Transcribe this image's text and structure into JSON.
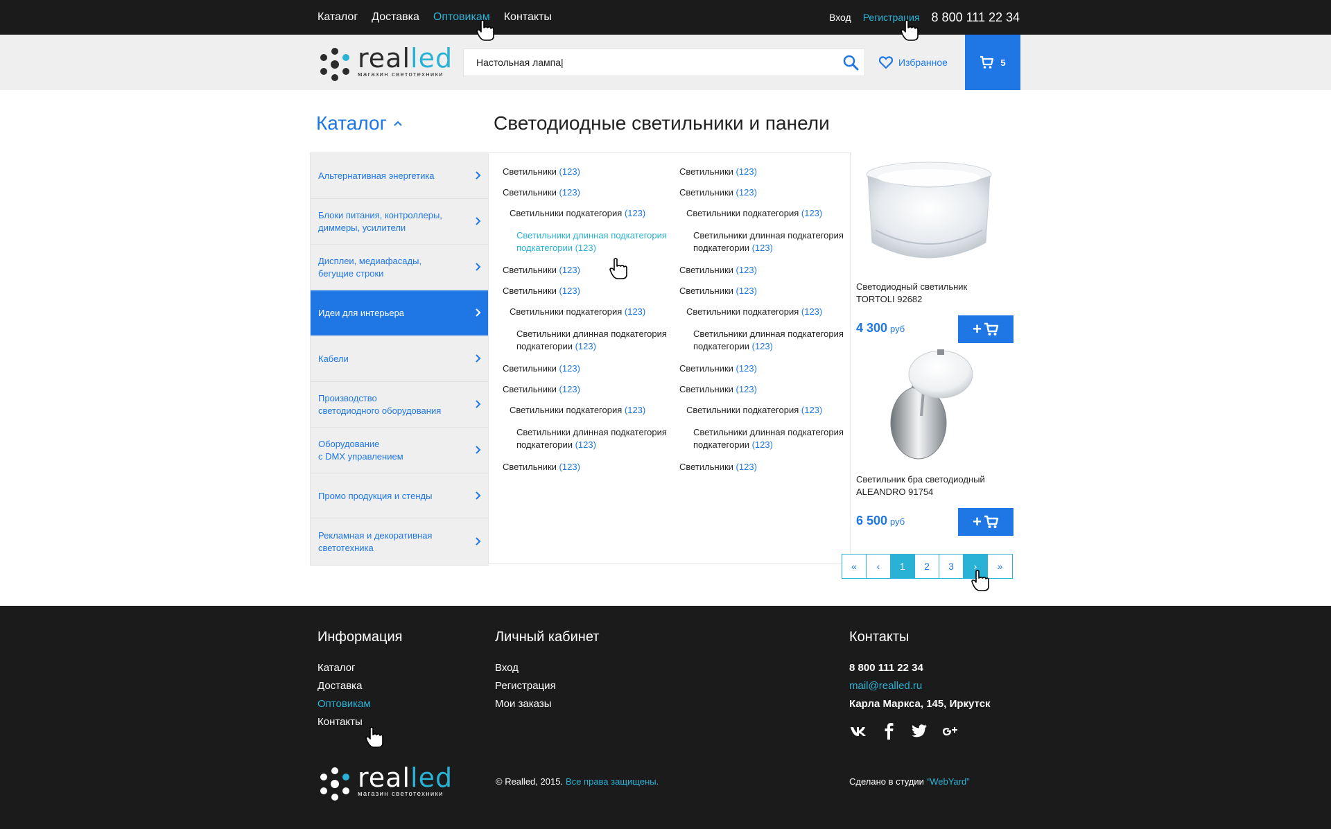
{
  "top_nav": {
    "items": [
      {
        "label": "Каталог"
      },
      {
        "label": "Доставка"
      },
      {
        "label": "Оптовикам"
      },
      {
        "label": "Контакты"
      }
    ],
    "login": "Вход",
    "register": "Регистрация",
    "phone": "8 800 111 22 34"
  },
  "logo": {
    "word_a": "real",
    "word_b": "led",
    "subtitle": "магазин светотехники"
  },
  "search": {
    "value": "Настольная лампа|",
    "icon": "search-icon"
  },
  "favorites": {
    "label": "Избранное",
    "icon": "heart-icon"
  },
  "cart": {
    "count": "5",
    "icon": "cart-icon"
  },
  "catalog_title": "Каталог",
  "page_title": "Светодиодные светильники и панели",
  "sidebar": {
    "items": [
      {
        "label": "Альтернативная энергетика",
        "active": false
      },
      {
        "label": "Блоки питания, контроллеры,\nдиммеры, усилители",
        "active": false
      },
      {
        "label": "Дисплеи, медиафасады,\nбегущие строки",
        "active": false
      },
      {
        "label": "Идеи для интерьера",
        "active": true
      },
      {
        "label": "Кабели",
        "active": false
      },
      {
        "label": "Производство\nсветодиодного оборудования",
        "active": false
      },
      {
        "label": "Оборудование\nс DMX управлением",
        "active": false
      },
      {
        "label": "Промо продукция и стенды",
        "active": false
      },
      {
        "label": "Рекламная и декоративная\nсветотехника",
        "active": false
      }
    ]
  },
  "subcats": {
    "col1": [
      {
        "text": "Светильники",
        "count": "(123)",
        "level": 1
      },
      {
        "text": "Светильники",
        "count": "(123)",
        "level": 1
      },
      {
        "text": "Светильники подкатегория",
        "count": "(123)",
        "level": 2
      },
      {
        "text": "Светильники длинная подкатегория подкатегории",
        "count": "(123)",
        "level": 3,
        "highlight": true
      },
      {
        "text": "Светильники",
        "count": "(123)",
        "level": 1
      },
      {
        "text": "Светильники",
        "count": "(123)",
        "level": 1
      },
      {
        "text": "Светильники подкатегория",
        "count": "(123)",
        "level": 2
      },
      {
        "text": "Светильники длинная подкатегория подкатегории",
        "count": "(123)",
        "level": 3
      },
      {
        "text": "Светильники",
        "count": "(123)",
        "level": 1
      },
      {
        "text": "Светильники",
        "count": "(123)",
        "level": 1
      },
      {
        "text": "Светильники подкатегория",
        "count": "(123)",
        "level": 2
      },
      {
        "text": "Светильники длинная подкатегория подкатегории",
        "count": "(123)",
        "level": 3
      },
      {
        "text": "Светильники",
        "count": "(123)",
        "level": 1
      }
    ],
    "col2": [
      {
        "text": "Светильники",
        "count": "(123)",
        "level": 1
      },
      {
        "text": "Светильники",
        "count": "(123)",
        "level": 1
      },
      {
        "text": "Светильники подкатегория",
        "count": "(123)",
        "level": 2
      },
      {
        "text": "Светильники длинная подкатегория подкатегории",
        "count": "(123)",
        "level": 3
      },
      {
        "text": "Светильники",
        "count": "(123)",
        "level": 1
      },
      {
        "text": "Светильники",
        "count": "(123)",
        "level": 1
      },
      {
        "text": "Светильники подкатегория",
        "count": "(123)",
        "level": 2
      },
      {
        "text": "Светильники длинная подкатегория подкатегории",
        "count": "(123)",
        "level": 3
      },
      {
        "text": "Светильники",
        "count": "(123)",
        "level": 1
      },
      {
        "text": "Светильники",
        "count": "(123)",
        "level": 1
      },
      {
        "text": "Светильники подкатегория",
        "count": "(123)",
        "level": 2
      },
      {
        "text": "Светильники длинная подкатегория подкатегории",
        "count": "(123)",
        "level": 3
      },
      {
        "text": "Светильники",
        "count": "(123)",
        "level": 1
      }
    ]
  },
  "products": [
    {
      "name": "Светодиодный светильник\nTORTOLI 92682",
      "price": "4 300",
      "currency": "руб",
      "add_label": "+"
    },
    {
      "name": "Светильник бра светодиодный\nALEANDRO 91754",
      "price": "6 500",
      "currency": "руб",
      "add_label": "+"
    }
  ],
  "pagination": {
    "first": "«",
    "prev": "‹",
    "pages": [
      "1",
      "2",
      "3"
    ],
    "current": "1",
    "next": "›",
    "last": "»"
  },
  "footer": {
    "info": {
      "title": "Информация",
      "links": [
        "Каталог",
        "Доставка",
        "Оптовикам",
        "Контакты"
      ]
    },
    "account": {
      "title": "Личный кабинет",
      "links": [
        "Вход",
        "Регистрация",
        "Мои заказы"
      ]
    },
    "contacts": {
      "title": "Контакты",
      "phone": "8 800 111 22 34",
      "email": "mail@realled.ru",
      "address": "Карла Маркса, 145, Иркутск",
      "socials": [
        "vk-icon",
        "facebook-icon",
        "twitter-icon",
        "google-plus-icon"
      ]
    },
    "copyright": "© Realled, 2015.",
    "rights": "Все права защищены.",
    "studio_prefix": "Сделано в студии",
    "studio_name": "“WebYard”"
  },
  "colors": {
    "brand_blue": "#1f77e6",
    "accent_cyan": "#29b2d6",
    "dark_bg": "#1b1b1b",
    "header_bg": "#efefef"
  }
}
